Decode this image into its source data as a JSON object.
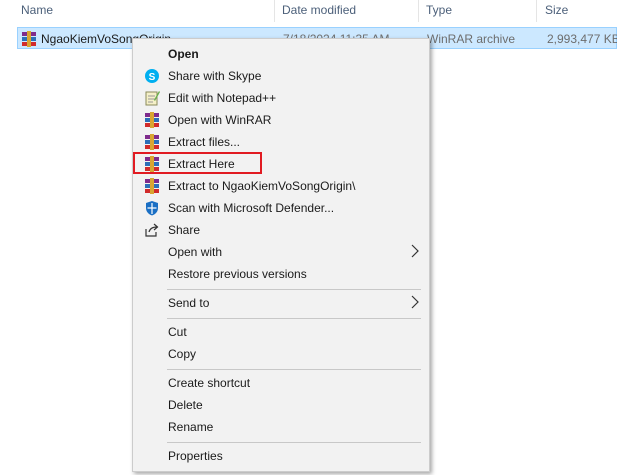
{
  "columns": {
    "name": "Name",
    "date_modified": "Date modified",
    "type": "Type",
    "size": "Size"
  },
  "file_row": {
    "name": "NgaoKiemVoSongOrigin",
    "date": "7/18/2024 11:35 AM",
    "type": "WinRAR archive",
    "size": "2,993,477 KB",
    "icon": "winrar-archive-icon"
  },
  "menu": {
    "open": "Open",
    "share_skype": "Share with Skype",
    "edit_notepad": "Edit with Notepad++",
    "open_winrar": "Open with WinRAR",
    "extract_files": "Extract files...",
    "extract_here": "Extract Here",
    "extract_to": "Extract to NgaoKiemVoSongOrigin\\",
    "scan_defender": "Scan with Microsoft Defender...",
    "share": "Share",
    "open_with": "Open with",
    "restore": "Restore previous versions",
    "send_to": "Send to",
    "cut": "Cut",
    "copy": "Copy",
    "create_shortcut": "Create shortcut",
    "delete": "Delete",
    "rename": "Rename",
    "properties": "Properties"
  },
  "colors": {
    "selection": "#cce8ff",
    "highlight_box": "#e11b22",
    "menu_bg": "#f2f2f2"
  }
}
